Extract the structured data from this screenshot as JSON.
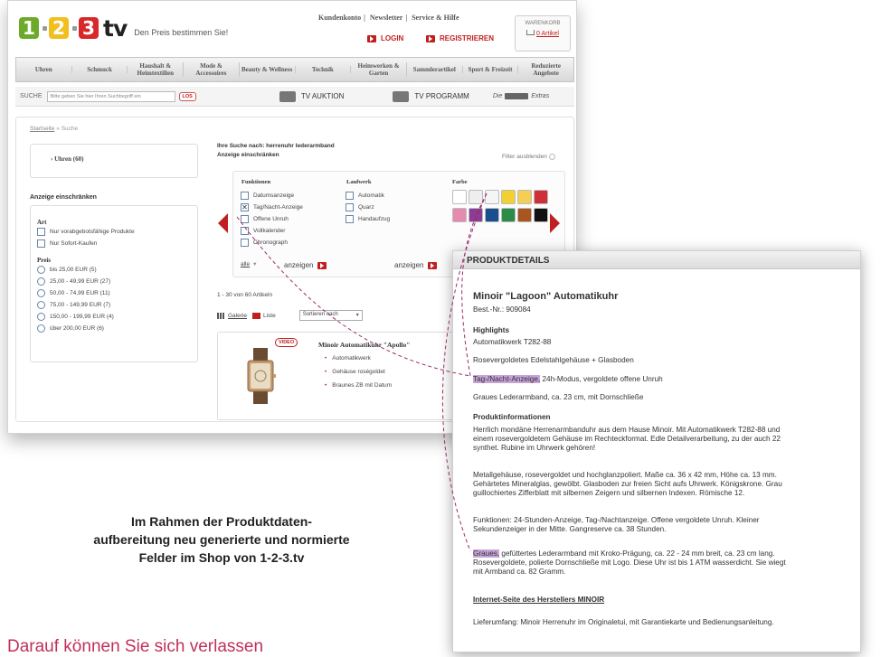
{
  "header": {
    "logo": {
      "d1": "1",
      "d2": "2",
      "d3": "3",
      "tv": "tv",
      "slogan": "Den Preis bestimmen Sie!"
    },
    "top_links": [
      "Kundenkonto",
      "Newsletter",
      "Service & Hilfe"
    ],
    "login": "LOGIN",
    "register": "REGISTRIEREN",
    "cart": {
      "title": "WARENKORB",
      "items": "0 Artikel"
    }
  },
  "nav": [
    "Uhren",
    "Schmuck",
    "Haushalt & Heimtextilien",
    "Mode & Accessoires",
    "Beauty & Wellness",
    "Technik",
    "Heimwerken & Garten",
    "Sammlerartikel",
    "Sport & Freizeit",
    "Reduzierte Angebote"
  ],
  "search": {
    "label": "SUCHE",
    "placeholder": "Bitte geben Sie hier Ihren Suchbegriff ein",
    "go": "LOS",
    "tv_auktion": "TV AUKTION",
    "tv_programm": "TV PROGRAMM",
    "extras_prefix": "Die",
    "extras_suffix": "Extras"
  },
  "breadcrumb": {
    "home": "Startseite",
    "sep": "»",
    "current": "Suche"
  },
  "left": {
    "category": "› Uhren (60)",
    "restrict_label": "Anzeige einschränken",
    "art_title": "Art",
    "art_options": [
      "Nur vorabgebotsfähige Produkte",
      "Nur Sofort-Kaufen"
    ],
    "price_title": "Preis",
    "price_options": [
      "bis 25,00 EUR (5)",
      "25,00 - 49,99 EUR (27)",
      "50,00 - 74,99 EUR (11)",
      "75,00 - 149,99 EUR (7)",
      "150,00 - 199,99 EUR (4)",
      "über 200,00 EUR (6)"
    ]
  },
  "main": {
    "search_text": "Ihre Suche nach: herrenuhr lederarmband",
    "restrict_label": "Anzeige einschränken",
    "hide_filter": "Filter ausblenden",
    "functions_title": "Funktionen",
    "functions": [
      {
        "label": "Datumsanzeige",
        "checked": false
      },
      {
        "label": "Tag/Nacht-Anzeige",
        "checked": true
      },
      {
        "label": "Offene Unruh",
        "checked": false
      },
      {
        "label": "Vollkalender",
        "checked": false
      },
      {
        "label": "Chronograph",
        "checked": false
      }
    ],
    "laufwerk_title": "Laufwerk",
    "laufwerk": [
      "Automatik",
      "Quarz",
      "Handaufzug"
    ],
    "farbe_title": "Farbe",
    "colors": [
      "#ffffff",
      "#eeeeee",
      "#f5f5f5",
      "#f1d030",
      "#f3cf55",
      "#cf2f36",
      "#e58bb0",
      "#8d3b97",
      "#1a4f8f",
      "#2a8c46",
      "#a8551f",
      "#111111"
    ],
    "all_label": "alle",
    "show_label": "anzeigen",
    "results": "1 - 30 von 60 Artikeln",
    "view_gallery": "Galerie",
    "view_list": "Liste",
    "sort": "Sortieren nach"
  },
  "product": {
    "video": "VIDEO",
    "title": "Minoir Automatikuhr \"Apollo\"",
    "bullets": [
      "Automatikwerk",
      "Gehäuse roségoldet",
      "Braunes ZB mit Datum"
    ]
  },
  "detail": {
    "header": "PRODUKTDETAILS",
    "title": "Minoir \"Lagoon\" Automatikuhr",
    "sku": "Best.-Nr.: 909084",
    "highlights_title": "Highlights",
    "h1": "Automatikwerk T282-88",
    "h2": "Rosevergoldetes Edelstahlgehäuse + Glasboden",
    "h3_hl": "Tag-/Nacht-Anzeige,",
    "h3_rest": " 24h-Modus, vergoldete offene Unruh",
    "h4": "Graues Lederarmband, ca. 23 cm, mit Dornschließe",
    "info_title": "Produktinformationen",
    "p1a": "Herrlich mondäne Herrenarmbanduhr aus dem Hause Minoir. Mit Automatikwerk T282-88 und",
    "p1b": "einem rosevergoldetem Gehäuse im Rechteckformat. Edle Detailverarbeitung, zu der auch 22",
    "p1c": "synthet. Rubine im Uhrwerk gehören!",
    "p2a": "Metallgehäuse, rosevergoldet und hochglanzpoliert. Maße ca. 36 x 42 mm, Höhe ca. 13 mm.",
    "p2b": "Gehärtetes Mineralglas, gewölbt. Glasboden zur freien Sicht aufs Uhrwerk. Königskrone. Grau",
    "p2c": "guillochiertes Zifferblatt mit silbernen Zeigern und silbernen Indexen. Römische 12.",
    "p3a": "Funktionen: 24-Stunden-Anzeige, Tag-/Nachtanzeige. Offene vergoldete Unruh. Kleiner",
    "p3b": "Sekundenzeiger in der Mitte. Gangreserve ca. 38 Stunden.",
    "p4a_hl": "Graues,",
    "p4a_rest": " gefüttertes Lederarmband mit Kroko-Prägung, ca. 22 - 24 mm breit, ca. 23 cm lang.",
    "p4b": "Rosevergoldete, polierte Dornschließe mit Logo. Diese Uhr ist bis 1 ATM wasserdicht. Sie wiegt",
    "p4c": "mit Armband ca. 82 Gramm.",
    "link": "Internet-Seite des Herstellers MINOIR",
    "scope": "Lieferumfang: Minoir Herrenuhr im Originaletui, mit Garantiekarte und Bedienungsanleitung."
  },
  "caption": [
    "Im Rahmen der Produktdaten-",
    "aufbereitung neu generierte und normierte",
    "Felder im Shop von 1-2-3.tv"
  ],
  "bottom_text": "Darauf können Sie sich verlassen"
}
